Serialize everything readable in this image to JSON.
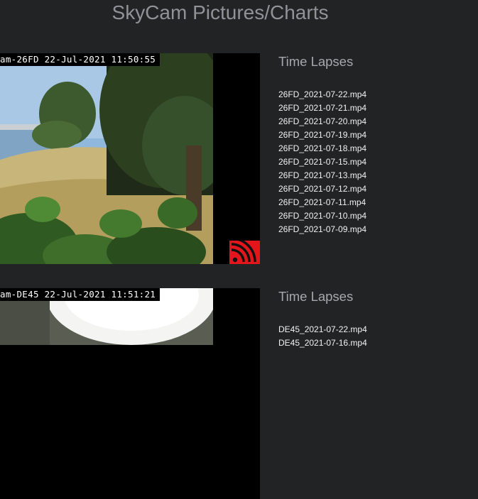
{
  "page": {
    "title": "SkyCam Pictures/Charts"
  },
  "cameras": [
    {
      "stamp": "am-26FD 22-Jul-2021 11:50:55",
      "lapses_title": "Time Lapses",
      "files": [
        "26FD_2021-07-22.mp4",
        "26FD_2021-07-21.mp4",
        "26FD_2021-07-20.mp4",
        "26FD_2021-07-19.mp4",
        "26FD_2021-07-18.mp4",
        "26FD_2021-07-15.mp4",
        "26FD_2021-07-13.mp4",
        "26FD_2021-07-12.mp4",
        "26FD_2021-07-11.mp4",
        "26FD_2021-07-10.mp4",
        "26FD_2021-07-09.mp4"
      ]
    },
    {
      "stamp": "am-DE45 22-Jul-2021 11:51:21",
      "lapses_title": "Time Lapses",
      "files": [
        "DE45_2021-07-22.mp4",
        "DE45_2021-07-16.mp4"
      ]
    }
  ],
  "icons": {
    "feed": "rss-feed-icon"
  },
  "colors": {
    "background": "#222325",
    "rss": "#e4151b"
  }
}
